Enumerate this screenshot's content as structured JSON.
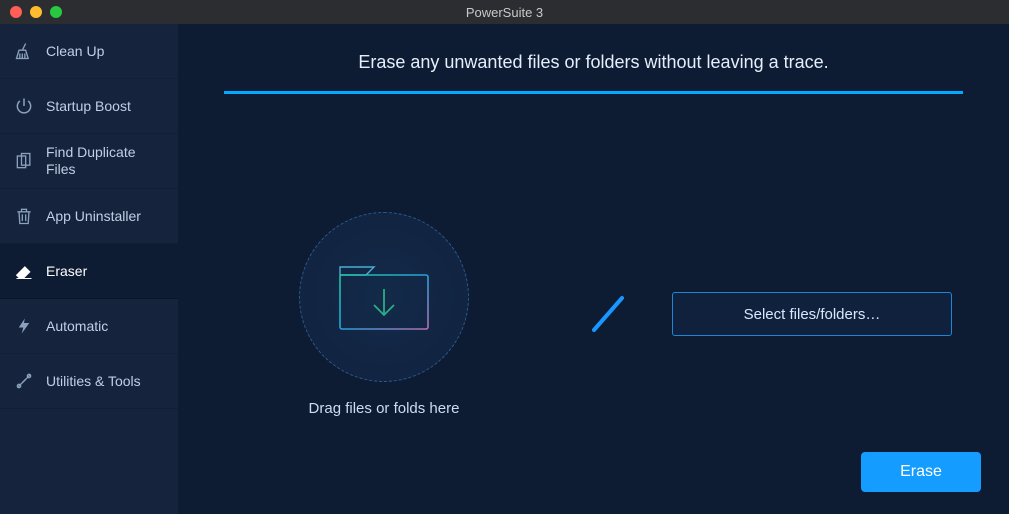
{
  "window": {
    "title": "PowerSuite 3"
  },
  "sidebar": {
    "items": [
      {
        "label": "Clean Up"
      },
      {
        "label": "Startup Boost"
      },
      {
        "label": "Find Duplicate Files"
      },
      {
        "label": "App Uninstaller"
      },
      {
        "label": "Eraser"
      },
      {
        "label": "Automatic"
      },
      {
        "label": "Utilities & Tools"
      }
    ]
  },
  "main": {
    "headline": "Erase any unwanted files or folders without leaving a trace.",
    "dropzone_label": "Drag files or folds here",
    "select_button": "Select files/folders…",
    "erase_button": "Erase"
  }
}
